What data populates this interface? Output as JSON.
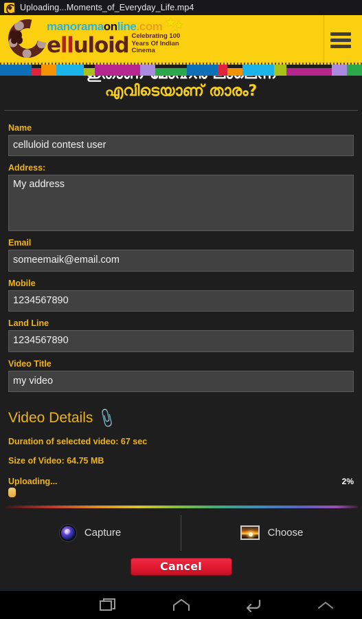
{
  "statusbar": {
    "notification_icon": "celluloid-app-icon",
    "title": "Uploading...Moments_of_Everyday_Life.mp4"
  },
  "header": {
    "brand_site": {
      "part1": "manorama",
      "part2": "on",
      "part3": "line",
      "part4": ".com"
    },
    "brand_name_1": "e",
    "brand_name_2": "ll",
    "brand_name_3": "uloid",
    "tagline_line1": "Celebrating 100",
    "tagline_line2": "Years Of Indian",
    "tagline_line3": "Cinema",
    "menu_icon": "hamburger-icon",
    "background_color": "#fbd010",
    "stripe_colors": [
      "#0d6fb8",
      "#e0243c",
      "#f39200",
      "#1ab4e8",
      "#a8c21a",
      "#b5268e",
      "#a98ae0",
      "#2aa84a",
      "#0d6fb8",
      "#e0243c",
      "#f39200",
      "#1ab4e8",
      "#a8c21a",
      "#b5268e",
      "#a98ae0",
      "#2aa84a"
    ]
  },
  "page_title": {
    "line1": "ഇതാണ് മോഹൻ ലാലെന്ന",
    "line2": "എവിടെയാണ് താരം?"
  },
  "form": {
    "fields": [
      {
        "label": "Name",
        "value": "celluloid contest user",
        "type": "text",
        "name": "name-input"
      },
      {
        "label": "Address:",
        "value": "My address",
        "type": "textarea",
        "name": "address-input"
      },
      {
        "label": "Email",
        "value": "someemaik@email.com",
        "type": "text",
        "name": "email-input"
      },
      {
        "label": "Mobile",
        "value": "1234567890",
        "type": "text",
        "name": "mobile-input"
      },
      {
        "label": "Land Line",
        "value": "1234567890",
        "type": "text",
        "name": "landline-input"
      },
      {
        "label": "Video Title",
        "value": "my video",
        "type": "text",
        "name": "video-title-input"
      }
    ]
  },
  "video_details": {
    "heading": "Video Details",
    "attach_icon": "paperclip-icon",
    "duration_text": "Duration of selected video: 67 sec",
    "size_text": "Size of Video: 64.75 MB",
    "upload_status": "Uploading...",
    "upload_percent_label": "2%",
    "upload_percent_value": 2,
    "accent_color": "#f0b310"
  },
  "picker": {
    "capture_label": "Capture",
    "capture_icon": "camera-lens-icon",
    "choose_label": "Choose",
    "choose_icon": "photo-thumbnail-icon"
  },
  "actions": {
    "cancel_label": "Cancel",
    "cancel_color": "#e01830"
  },
  "navbar": {
    "recents_icon": "recents-icon",
    "home_icon": "home-icon",
    "back_icon": "back-icon",
    "expand_icon": "chevron-up-icon"
  }
}
